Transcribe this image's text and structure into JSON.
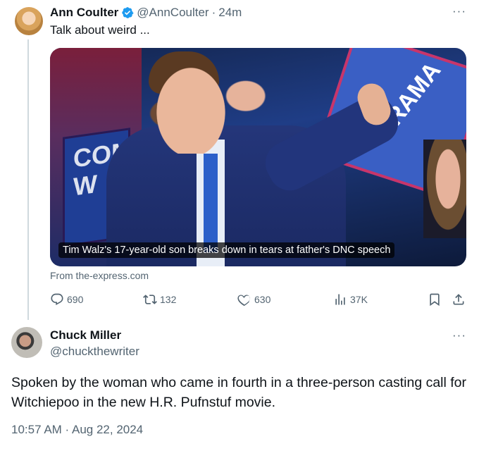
{
  "tweet": {
    "display_name": "Ann Coulter",
    "handle": "@AnnCoulter",
    "separator": "·",
    "time_ago": "24m",
    "text": "Talk about weird ...",
    "media": {
      "caption": "Tim Walz's 17-year-old son breaks down in tears at father's DNC speech",
      "sign_left_text": "COM W",
      "sign_right_text": "RAMA"
    },
    "source": "From the-express.com",
    "more_label": "···",
    "icons": {
      "verified": "verified-badge-icon",
      "reply": "reply-icon",
      "retweet": "retweet-icon",
      "like": "heart-icon",
      "views": "views-icon",
      "bookmark": "bookmark-icon",
      "share": "share-icon"
    },
    "stats": {
      "replies": "690",
      "retweets": "132",
      "likes": "630",
      "views": "37K"
    }
  },
  "reply": {
    "display_name": "Chuck Miller",
    "handle": "@chuckthewriter",
    "more_label": "···",
    "text": "Spoken by the woman who came in fourth in a three-person casting call for Witchiepoo in the new H.R. Pufnstuf movie.",
    "timestamp": "10:57 AM · Aug 22, 2024"
  },
  "colors": {
    "text_primary": "#0f1419",
    "text_secondary": "#536471",
    "verified_blue": "#1d9bf0",
    "thread_line": "#cfd9de"
  }
}
